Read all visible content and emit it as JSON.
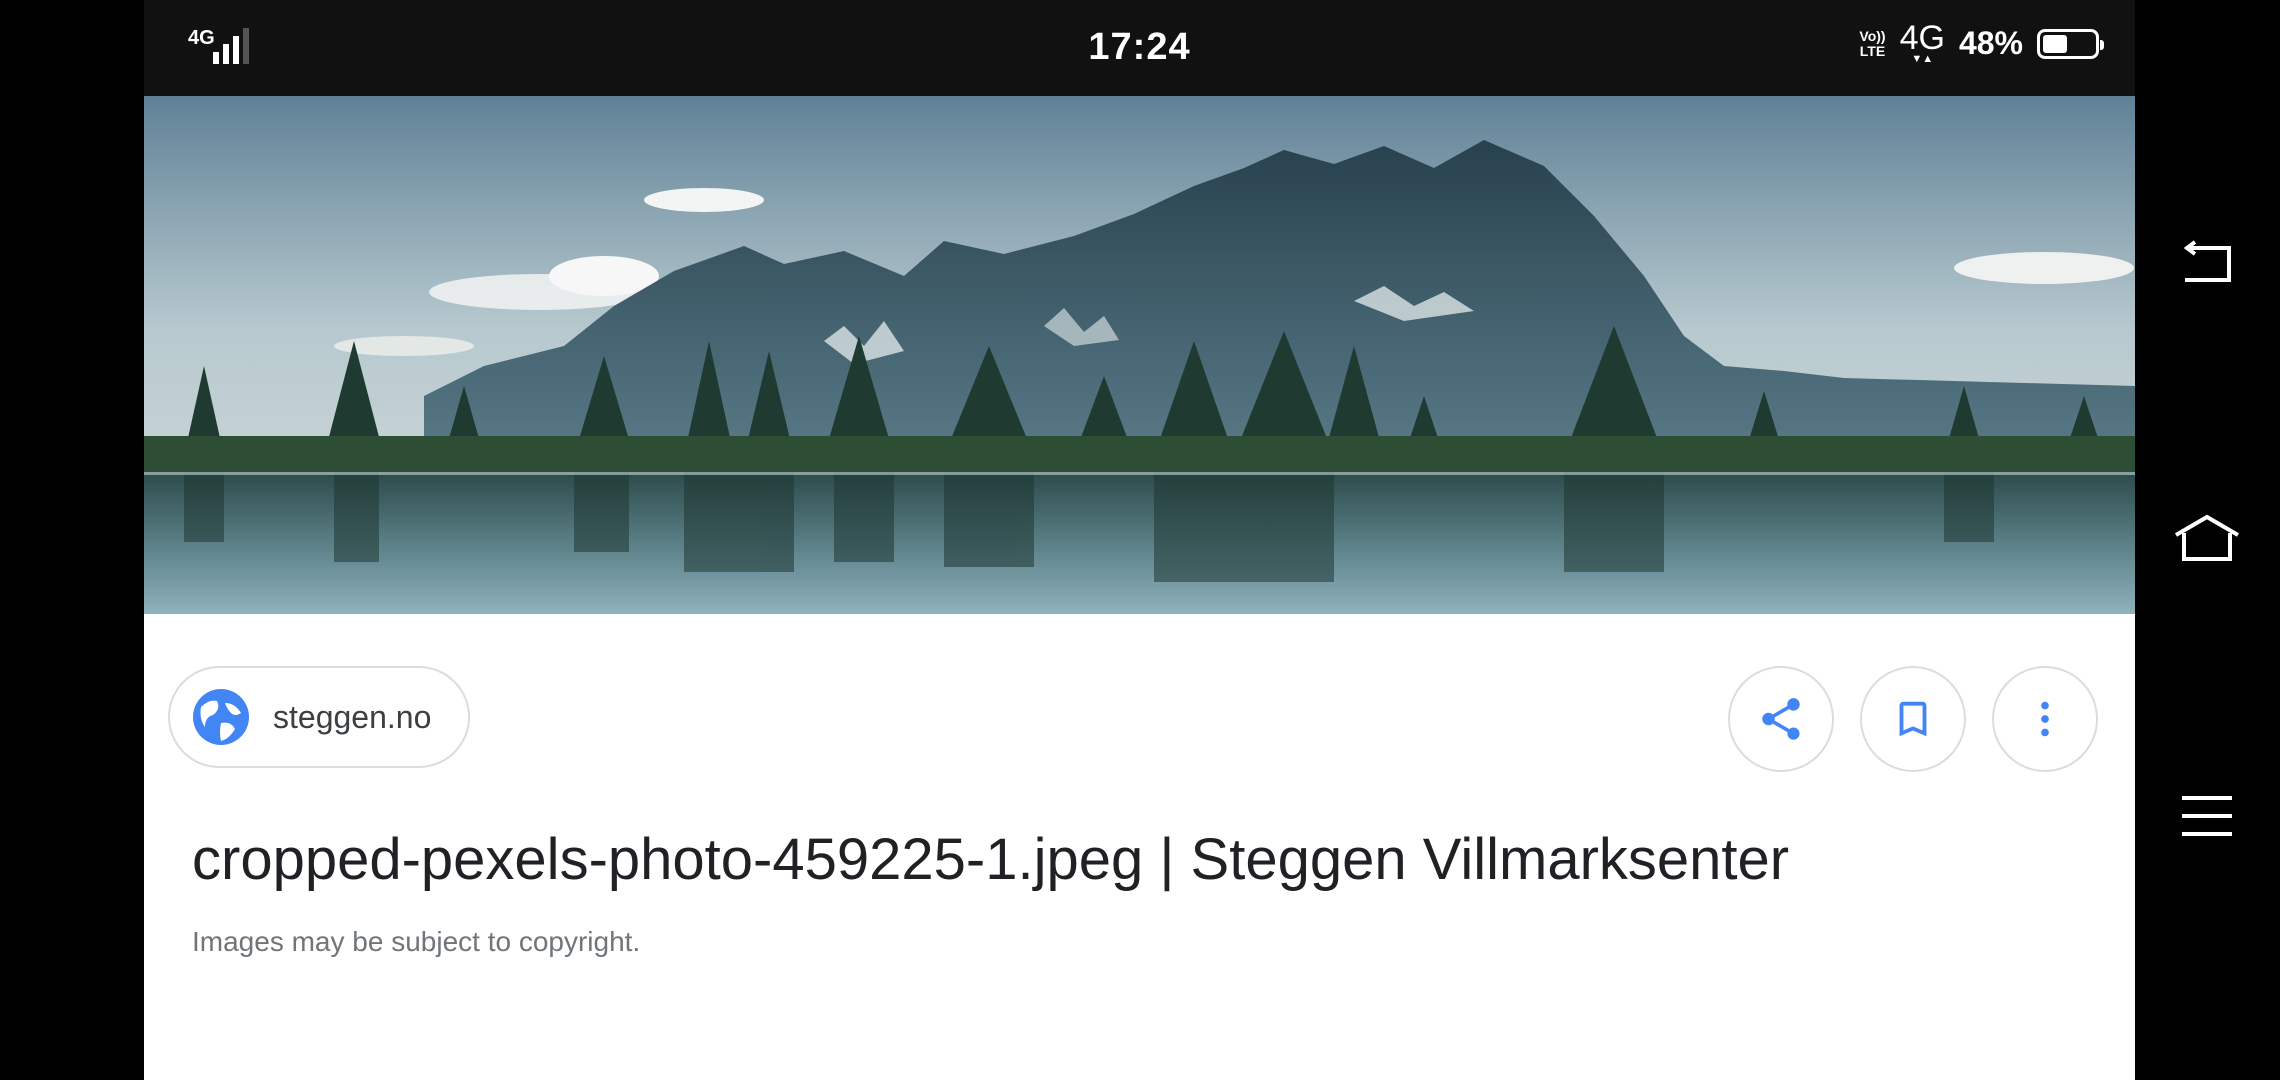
{
  "status_bar": {
    "network_left": "4G",
    "time": "17:24",
    "volte_top": "Vo))",
    "volte_bottom": "LTE",
    "network_right": "4G",
    "battery_percent": "48%",
    "battery_level": 0.48
  },
  "hero_image": {
    "icon": "mountain-lake-photo"
  },
  "source": {
    "site": "steggen.no",
    "icon": "globe-icon",
    "accent_color": "#4285f4"
  },
  "actions": {
    "share_icon": "share-icon",
    "bookmark_icon": "bookmark-icon",
    "more_icon": "more-vert-icon"
  },
  "image_title": "cropped-pexels-photo-459225-1.jpeg | Steggen Villmarksenter",
  "copyright_note": "Images may be subject to copyright.",
  "nav": {
    "back_icon": "back-icon",
    "home_icon": "home-icon",
    "menu_icon": "menu-icon"
  }
}
